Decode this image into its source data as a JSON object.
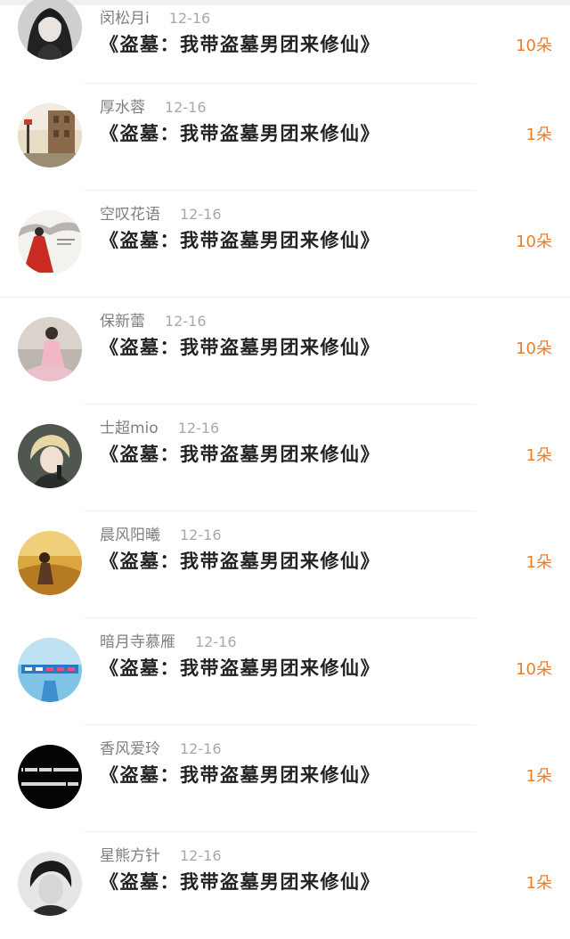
{
  "gifts": {
    "items": [
      {
        "name": "闵松月i",
        "date": "12-16",
        "title": "《盗墓：我带盗墓男团来修仙》",
        "amount": "10朵",
        "avatar_icon": "avatar-girl-portrait-icon"
      },
      {
        "name": "厚水蓉",
        "date": "12-16",
        "title": "《盗墓：我带盗墓男团来修仙》",
        "amount": "1朵",
        "avatar_icon": "avatar-street-scene-icon"
      },
      {
        "name": "空叹花语",
        "date": "12-16",
        "title": "《盗墓：我带盗墓男团来修仙》",
        "amount": "10朵",
        "avatar_icon": "avatar-red-dress-painting-icon"
      },
      {
        "name": "保新蕾",
        "date": "12-16",
        "title": "《盗墓：我带盗墓男团来修仙》",
        "amount": "10朵",
        "avatar_icon": "avatar-pink-dress-girl-icon"
      },
      {
        "name": "士超mio",
        "date": "12-16",
        "title": "《盗墓：我带盗墓男团来修仙》",
        "amount": "1朵",
        "avatar_icon": "avatar-blond-singer-icon"
      },
      {
        "name": "晨风阳曦",
        "date": "12-16",
        "title": "《盗墓：我带盗墓男团来修仙》",
        "amount": "1朵",
        "avatar_icon": "avatar-golden-field-icon"
      },
      {
        "name": "暗月寺慕雁",
        "date": "12-16",
        "title": "《盗墓：我带盗墓男团来修仙》",
        "amount": "10朵",
        "avatar_icon": "avatar-blue-text-image-icon"
      },
      {
        "name": "香风爱玲",
        "date": "12-16",
        "title": "《盗墓：我带盗墓男团来修仙》",
        "amount": "1朵",
        "avatar_icon": "avatar-black-text-image-icon"
      },
      {
        "name": "星熊方针",
        "date": "12-16",
        "title": "《盗墓：我带盗墓男团来修仙》",
        "amount": "1朵",
        "avatar_icon": "avatar-bw-boy-portrait-icon"
      }
    ]
  }
}
